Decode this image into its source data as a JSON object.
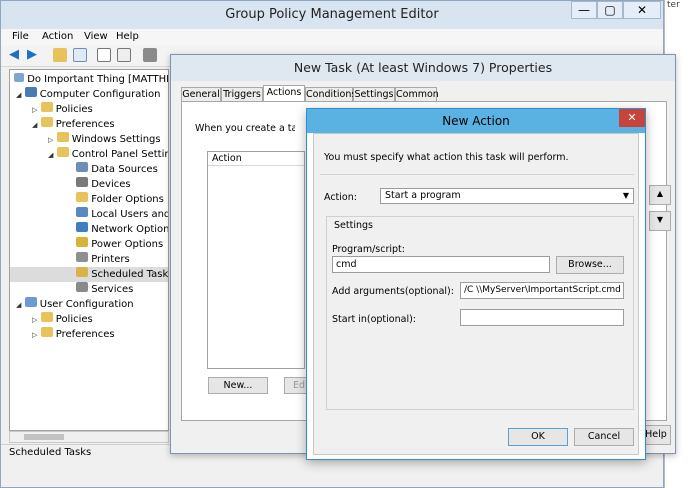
{
  "gpme": {
    "title": "Group Policy Management Editor",
    "menu": [
      "File",
      "Action",
      "View",
      "Help"
    ],
    "status": "Scheduled Tasks",
    "window_buttons": [
      "—",
      "▢",
      "✕"
    ]
  },
  "tree": {
    "root": "Do Important Thing [MATTHEV",
    "computer_config": "Computer Configuration",
    "policies": "Policies",
    "preferences": "Preferences",
    "windows_settings": "Windows Settings",
    "control_panel": "Control Panel Setting",
    "items": [
      "Data Sources",
      "Devices",
      "Folder Options",
      "Local Users and G",
      "Network Options",
      "Power Options",
      "Printers",
      "Scheduled Tasks",
      "Services"
    ],
    "user_config": "User Configuration",
    "user_policies": "Policies",
    "user_preferences": "Preferences"
  },
  "right_panel": {
    "text": "ter"
  },
  "props": {
    "title": "New Task (At least Windows 7) Properties",
    "tabs": [
      "General",
      "Triggers",
      "Actions",
      "Conditions",
      "Settings",
      "Common"
    ],
    "active_tab": "Actions",
    "desc": "When you create a task,",
    "list_header": "Action",
    "new_label": "New...",
    "edit_label": "Ed",
    "help_label": "Help"
  },
  "new_action": {
    "title": "New Action",
    "close": "✕",
    "intro": "You must specify what action this task will perform.",
    "action_label": "Action:",
    "action_value": "Start a program",
    "settings_label": "Settings",
    "program_label": "Program/script:",
    "program_value": "cmd",
    "browse_label": "Browse...",
    "args_label": "Add arguments(optional):",
    "args_value": "/C \\\\MyServer\\ImportantScript.cmd",
    "startin_label": "Start in(optional):",
    "startin_value": "",
    "ok_label": "OK",
    "cancel_label": "Cancel"
  },
  "colors": {
    "titlebar_blue": "#5ab2e2",
    "close_red": "#c7443a",
    "folder": "#e8c25a"
  }
}
